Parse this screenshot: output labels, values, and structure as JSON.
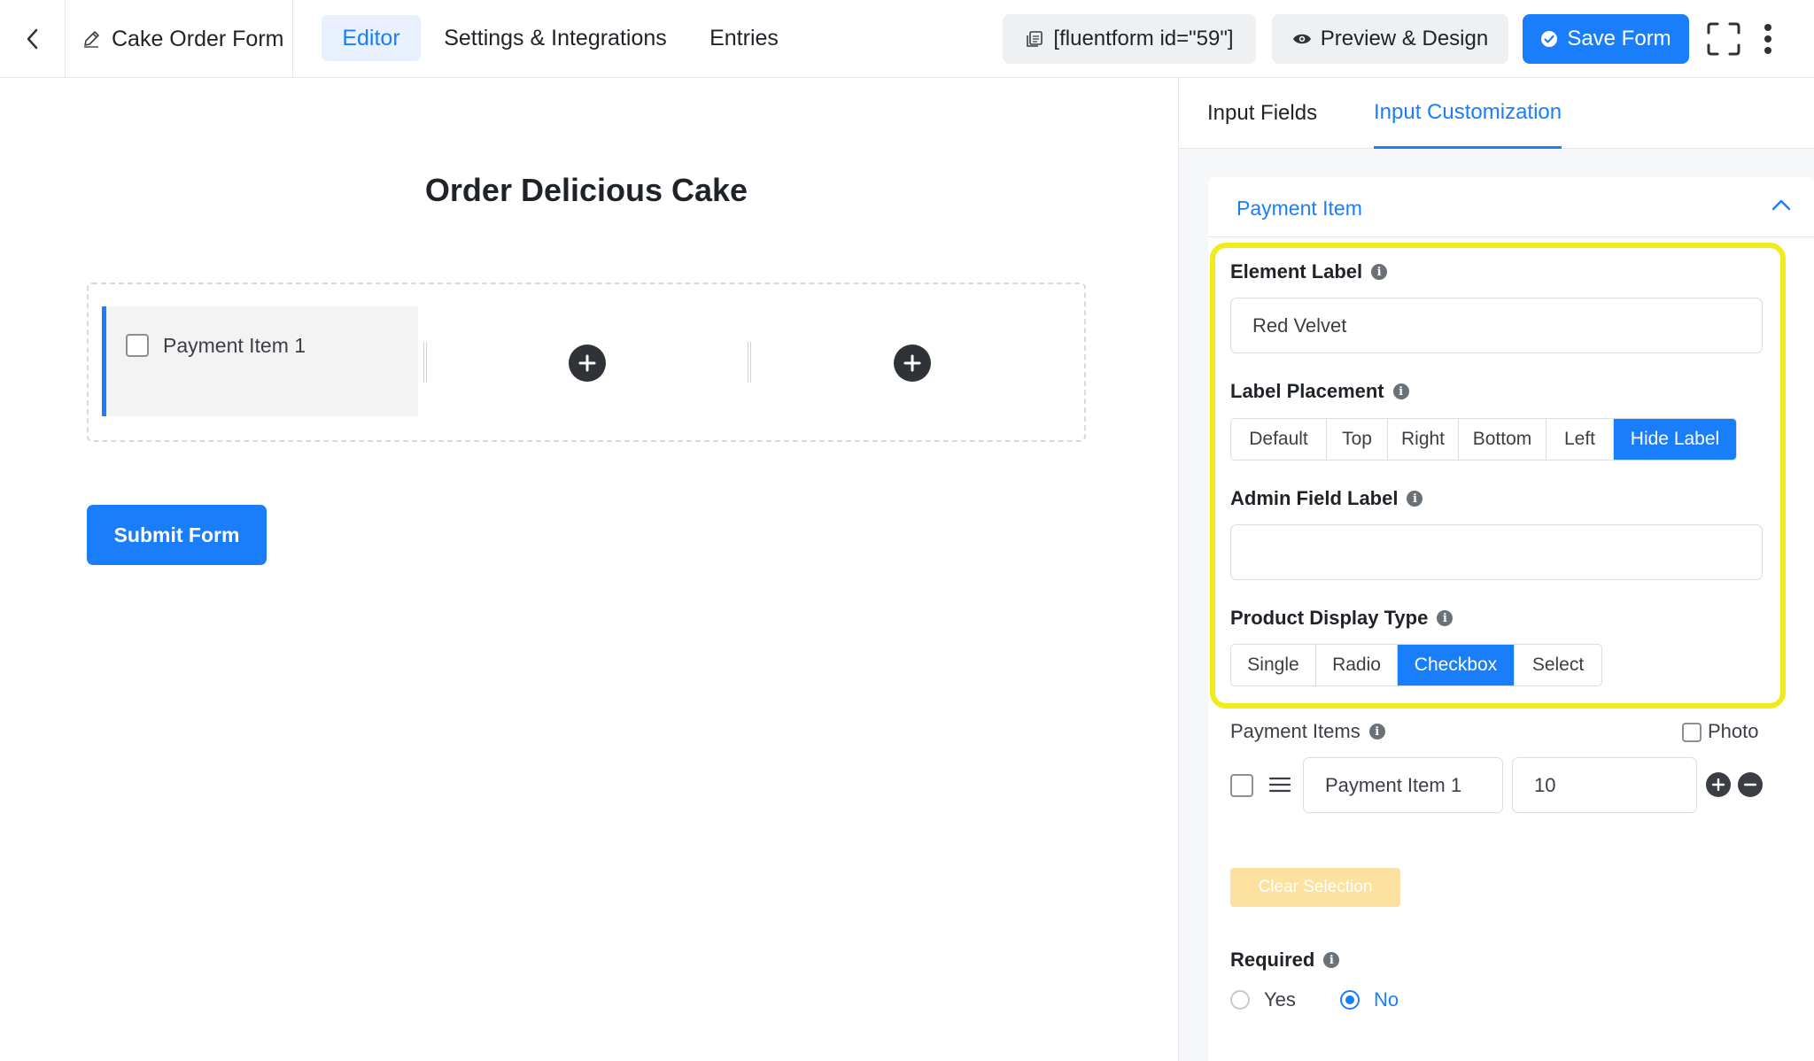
{
  "header": {
    "form_title": "Cake Order Form",
    "tabs": [
      {
        "label": "Editor",
        "active": true
      },
      {
        "label": "Settings & Integrations",
        "active": false
      },
      {
        "label": "Entries",
        "active": false
      }
    ],
    "shortcode": "[fluentform id=\"59\"]",
    "preview_label": "Preview & Design",
    "save_label": "Save Form"
  },
  "canvas": {
    "form_heading": "Order Delicious Cake",
    "field_label": "Payment Item 1",
    "submit_label": "Submit Form"
  },
  "panel": {
    "tabs": [
      {
        "label": "Input Fields",
        "active": false
      },
      {
        "label": "Input Customization",
        "active": true
      }
    ],
    "section_title": "Payment Item",
    "element_label": {
      "label": "Element Label",
      "value": "Red Velvet"
    },
    "label_placement": {
      "label": "Label Placement",
      "options": [
        "Default",
        "Top",
        "Right",
        "Bottom",
        "Left",
        "Hide Label"
      ],
      "selected": "Hide Label"
    },
    "admin_field_label": {
      "label": "Admin Field Label",
      "value": ""
    },
    "product_display_type": {
      "label": "Product Display Type",
      "options": [
        "Single",
        "Radio",
        "Checkbox",
        "Select"
      ],
      "selected": "Checkbox"
    },
    "payment_items": {
      "label": "Payment Items",
      "photo_label": "Photo",
      "items": [
        {
          "label": "Payment Item 1",
          "price": "10"
        }
      ]
    },
    "clear_selection_label": "Clear Selection",
    "required": {
      "label": "Required",
      "yes": "Yes",
      "no": "No",
      "selected": "No"
    }
  },
  "colors": {
    "accent": "#1a7efb",
    "highlight": "#f3ea1a"
  }
}
